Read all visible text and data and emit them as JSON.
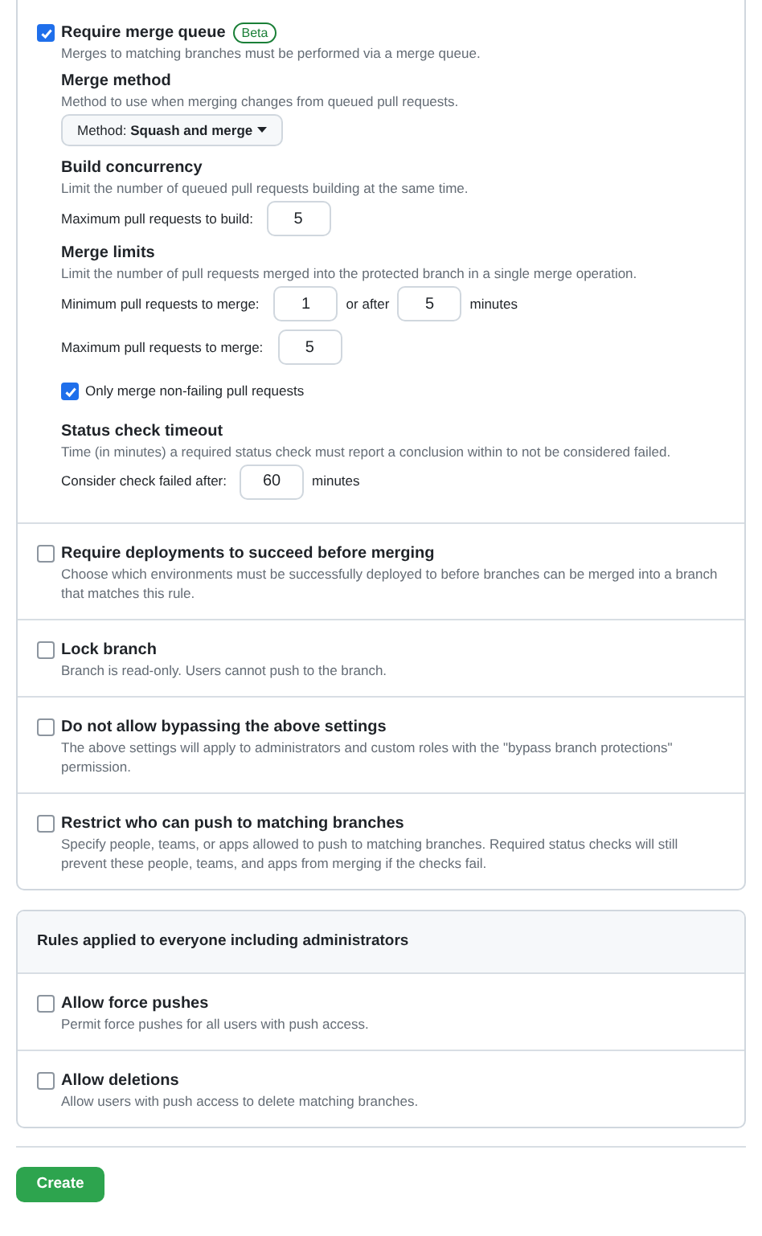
{
  "merge_queue": {
    "label": "Require merge queue",
    "checked": true,
    "badge": "Beta",
    "description": "Merges to matching branches must be performed via a merge queue.",
    "merge_method": {
      "title": "Merge method",
      "description": "Method to use when merging changes from queued pull requests.",
      "dropdown": "Method: **Squash and merge**"
    },
    "build_concurrency": {
      "title": "Build concurrency",
      "description": "Limit the number of queued pull requests building at the same time.",
      "field_label": "Maximum pull requests to build:",
      "value": "5"
    },
    "merge_limits": {
      "title": "Merge limits",
      "description": "Limit the number of pull requests merged into the protected branch in a single merge operation.",
      "min_label": "Minimum pull requests to merge:",
      "min_value": "1",
      "or_after": "or after",
      "wait_value": "5",
      "wait_unit": "minutes",
      "max_label": "Maximum pull requests to merge:",
      "max_value": "5"
    },
    "non_failing": {
      "label": "Only merge non-failing pull requests",
      "checked": true
    },
    "status_check_timeout": {
      "title": "Status check timeout",
      "description": "Time (in minutes) a required status check must report a conclusion within to not be considered failed.",
      "field_label": "Consider check failed after:",
      "value": "60",
      "unit": "minutes"
    }
  },
  "rules": [
    {
      "label": "Require deployments to succeed before merging",
      "checked": false,
      "description": "Choose which environments must be successfully deployed to before branches can be merged into a branch that matches this rule."
    },
    {
      "label": "Lock branch",
      "checked": false,
      "description": "Branch is read-only. Users cannot push to the branch."
    },
    {
      "label": "Do not allow bypassing the above settings",
      "checked": false,
      "description": "The above settings will apply to administrators and custom roles with the \"bypass branch protections\" permission."
    },
    {
      "label": "Restrict who can push to matching branches",
      "checked": false,
      "description": "Specify people, teams, or apps allowed to push to matching branches. Required status checks will still prevent these people, teams, and apps from merging if the checks fail."
    }
  ],
  "everyone": {
    "title": "Rules applied to everyone including administrators",
    "rules": [
      {
        "label": "Allow force pushes",
        "checked": false,
        "description": "Permit force pushes for all users with push access."
      },
      {
        "label": "Allow deletions",
        "checked": false,
        "description": "Allow users with push access to delete matching branches."
      }
    ]
  },
  "create_button": "Create"
}
